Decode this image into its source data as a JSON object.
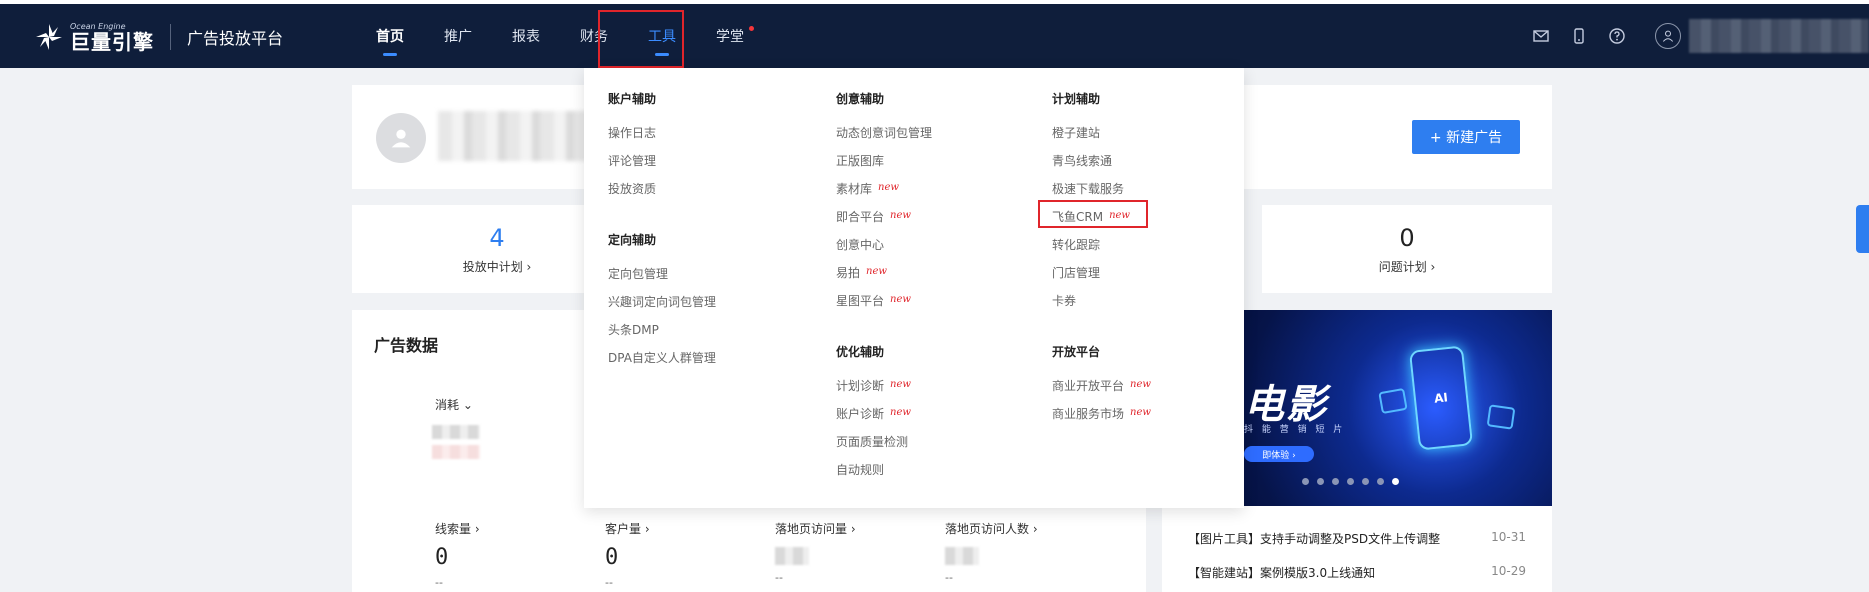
{
  "brand": {
    "en": "Ocean Engine",
    "cn": "巨量引擎",
    "platform": "广告投放平台"
  },
  "nav": [
    {
      "label": "首页"
    },
    {
      "label": "推广"
    },
    {
      "label": "报表"
    },
    {
      "label": "财务"
    },
    {
      "label": "工具"
    },
    {
      "label": "学堂"
    }
  ],
  "profile": {
    "new_ad_button": "+ 新建广告"
  },
  "stats": [
    {
      "value": "4",
      "label": "投放中计划 ›"
    },
    {
      "value": "0",
      "label": "问题计划 ›"
    }
  ],
  "ad_data": {
    "title": "广告数据",
    "metric_select": "消耗 ⌄",
    "metrics": [
      {
        "label": "线索量 ›",
        "value": "0",
        "delta": "--"
      },
      {
        "label": "客户量 ›",
        "value": "0",
        "delta": "--"
      },
      {
        "label": "落地页访问量 ›",
        "delta": "--"
      },
      {
        "label": "落地页访问人数 ›",
        "delta": "--"
      }
    ]
  },
  "banner": {
    "title": "电影",
    "sub": "抖 能 营 销 短 片",
    "cta": "即体验 ›",
    "badge": "AI"
  },
  "news": [
    {
      "text": "【图片工具】支持手动调整及PSD文件上传调整",
      "date": "10-31"
    },
    {
      "text": "【智能建站】案例模版3.0上线通知",
      "date": "10-29"
    }
  ],
  "tools_menu": {
    "account": {
      "title": "账户辅助",
      "items": [
        "操作日志",
        "评论管理",
        "投放资质"
      ]
    },
    "targeting": {
      "title": "定向辅助",
      "items": [
        "定向包管理",
        "兴趣词定向词包管理",
        "头条DMP",
        "DPA自定义人群管理"
      ]
    },
    "creative": {
      "title": "创意辅助",
      "items": [
        {
          "label": "动态创意词包管理",
          "new": ""
        },
        {
          "label": "正版图库",
          "new": ""
        },
        {
          "label": "素材库",
          "new": "new"
        },
        {
          "label": "即合平台",
          "new": "new"
        },
        {
          "label": "创意中心",
          "new": ""
        },
        {
          "label": "易拍",
          "new": "new"
        },
        {
          "label": "星图平台",
          "new": "new"
        }
      ]
    },
    "optimize": {
      "title": "优化辅助",
      "items": [
        {
          "label": "计划诊断",
          "new": "new"
        },
        {
          "label": "账户诊断",
          "new": "new"
        },
        {
          "label": "页面质量检测",
          "new": ""
        },
        {
          "label": "自动规则",
          "new": ""
        }
      ]
    },
    "plan": {
      "title": "计划辅助",
      "items": [
        {
          "label": "橙子建站",
          "new": ""
        },
        {
          "label": "青鸟线索通",
          "new": ""
        },
        {
          "label": "极速下载服务",
          "new": ""
        },
        {
          "label": "飞鱼CRM",
          "new": "new"
        },
        {
          "label": "转化跟踪",
          "new": ""
        },
        {
          "label": "门店管理",
          "new": ""
        },
        {
          "label": "卡券",
          "new": ""
        }
      ]
    },
    "open": {
      "title": "开放平台",
      "items": [
        {
          "label": "商业开放平台",
          "new": "new"
        },
        {
          "label": "商业服务市场",
          "new": "new"
        }
      ]
    }
  },
  "colors": {
    "nav_bg": "#0f1e3b",
    "accent": "#2e7ef0",
    "highlight": "#e0252b"
  }
}
